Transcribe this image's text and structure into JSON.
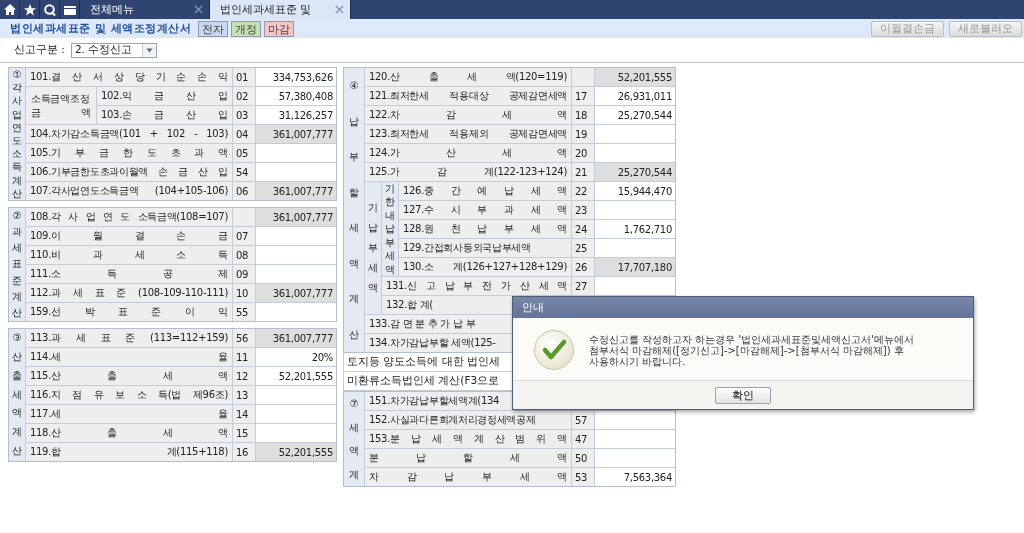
{
  "tabs": [
    {
      "label": "전체메뉴",
      "selected": false
    },
    {
      "label": "법인세과세표준 및",
      "selected": true
    }
  ],
  "form_title": "법인세과세표준 및 세액조정계산서",
  "badges": [
    {
      "label": "전자",
      "color": "#c8d8ee"
    },
    {
      "label": "개정",
      "color": "#c5e2b3"
    },
    {
      "label": "마감",
      "color": "#f6c4c4"
    }
  ],
  "toolbar_buttons": [
    {
      "label": "이월결손금",
      "disabled": true
    },
    {
      "label": "새로불러오",
      "disabled": true
    }
  ],
  "filing_type": {
    "label": "신고구분 :",
    "value": "2. 수정신고"
  },
  "panels": [
    [
      {
        "kind": "section",
        "header": "①각사업연도소득계산",
        "rows": [
          {
            "kind": "line",
            "label": "101.결 산 서 상 당 기 순 손 익",
            "code": "01",
            "value": "334,753,626",
            "computed": false
          },
          {
            "kind": "group",
            "label": "소득금액조정\n금 액",
            "rows": [
              {
                "kind": "line",
                "label": "102.익 금 산 입",
                "code": "02",
                "value": "57,380,408",
                "computed": false
              },
              {
                "kind": "line",
                "label": "103.손 금 산 입",
                "code": "03",
                "value": "31,126,257",
                "computed": false
              }
            ]
          },
          {
            "kind": "line",
            "label": "104.차가감소득금액(101 + 102 - 103)",
            "code": "04",
            "value": "361,007,777",
            "computed": true
          },
          {
            "kind": "line",
            "label": "105.기 부 금 한 도 초 과 액",
            "code": "05",
            "computed": false
          },
          {
            "kind": "line",
            "label": "106.기부금한도초과이월액 손 금 산 입",
            "code": "54",
            "computed": false
          },
          {
            "kind": "line",
            "label": "107.각사업연도소득금액 (104+105-106)",
            "code": "06",
            "value": "361,007,777",
            "computed": true
          }
        ]
      },
      {
        "kind": "section",
        "header": "②과세표준계산",
        "rows": [
          {
            "kind": "line",
            "label": "108.각 사 업 연 도 소득금액(108=107)",
            "value": "361,007,777",
            "computed": true
          },
          {
            "kind": "line",
            "label": "109.이 월 결 손 금",
            "code": "07",
            "computed": false
          },
          {
            "kind": "line",
            "label": "110.비 과 세 소 득",
            "code": "08",
            "computed": false
          },
          {
            "kind": "line",
            "label": "111.소 득 공 제",
            "code": "09",
            "computed": false
          },
          {
            "kind": "line",
            "label": "112.과 세 표 준 (108-109-110-111)",
            "code": "10",
            "value": "361,007,777",
            "computed": true
          },
          {
            "kind": "line",
            "label": "159.선 박 표 준 이 익",
            "code": "55",
            "computed": false
          }
        ]
      },
      {
        "kind": "section",
        "header": "③산출세액계산",
        "rows": [
          {
            "kind": "line",
            "label": "113.과 세 표 준 (113=112+159)",
            "code": "56",
            "value": "361,007,777",
            "computed": true
          },
          {
            "kind": "line",
            "label": "114.세 율",
            "code": "11",
            "value": "20%",
            "computed": false
          },
          {
            "kind": "line",
            "label": "115.산 출 세 액",
            "code": "12",
            "value": "52,201,555",
            "computed": false
          },
          {
            "kind": "line",
            "label": "116.지 점 유 보 소 득(법 제96조)",
            "code": "13",
            "computed": false
          },
          {
            "kind": "line",
            "label": "117.세 율",
            "code": "14",
            "computed": false
          },
          {
            "kind": "line",
            "label": "118.산 출 세 액",
            "code": "15",
            "computed": false
          },
          {
            "kind": "line",
            "label": "119.합 계(115+118)",
            "code": "16",
            "value": "52,201,555",
            "computed": true
          }
        ]
      }
    ],
    [
      {
        "kind": "section",
        "header": "④납부할세액계산",
        "rows": [
          {
            "kind": "line",
            "label": "120.산 출 세 액(120=119)",
            "value": "52,201,555",
            "computed": true
          },
          {
            "kind": "line",
            "label": "121.최저한세 적용대상 공제감면세액",
            "code": "17",
            "value": "26,931,011",
            "computed": false
          },
          {
            "kind": "line",
            "label": "122.차 감 세 액",
            "code": "18",
            "value": "25,270,544",
            "computed": false
          },
          {
            "kind": "line",
            "label": "123.최저한세 적용제외 공제감면세액",
            "code": "19",
            "computed": false
          },
          {
            "kind": "line",
            "label": "124.가 산 세 액",
            "code": "20",
            "computed": false
          },
          {
            "kind": "line",
            "label": "125.가 감 계(122-123+124)",
            "code": "21",
            "value": "25,270,544",
            "computed": true
          },
          {
            "kind": "group",
            "label": "기납부세액",
            "rows": [
              {
                "kind": "group",
                "label": "기한내납부세액",
                "rows": [
                  {
                    "kind": "line",
                    "label": "126.중 간 예 납 세 액",
                    "code": "22",
                    "value": "15,944,470",
                    "computed": false
                  },
                  {
                    "kind": "line",
                    "label": "127.수 시 부 과 세 액",
                    "code": "23",
                    "computed": false
                  },
                  {
                    "kind": "line",
                    "label": "128.원 천 납 부 세 액",
                    "code": "24",
                    "value": "1,762,710",
                    "computed": false
                  },
                  {
                    "kind": "line",
                    "label": "129.간접회사등외국납부세액",
                    "code": "25",
                    "computed": false
                  },
                  {
                    "kind": "line",
                    "label": "130.소 계(126+127+128+129)",
                    "code": "26",
                    "value": "17,707,180",
                    "computed": true
                  }
                ]
              },
              {
                "kind": "line",
                "label": "131.신 고 납 부 전 가 산 세 액",
                "code": "27",
                "computed": false
              },
              {
                "kind": "cut",
                "label": "132.합 계("
              }
            ]
          },
          {
            "kind": "cut",
            "label": "133.감 면 분 추 가 납 부"
          },
          {
            "kind": "cut",
            "label": "134.차가감납부할 세액(125-"
          }
        ]
      },
      {
        "kind": "note",
        "text": "토지등 양도소득에 대한 법인세"
      },
      {
        "kind": "note",
        "text": "미환류소득법인세 계산(F3으로"
      },
      {
        "kind": "section",
        "header": "⑦세액계",
        "rows": [
          {
            "kind": "cut",
            "label": "151.차가감납부할세액계(134"
          },
          {
            "kind": "line",
            "label": "152.사실과다른회계처리경정세액공제",
            "code": "57",
            "computed": false
          },
          {
            "kind": "line",
            "label": "153.분 납 세 액 계 산 범 위 액",
            "code": "47",
            "computed": false
          },
          {
            "kind": "line",
            "label": "분 납 할 세 액",
            "code": "50",
            "computed": false
          },
          {
            "kind": "line",
            "label": "차 감 납 부 세 액",
            "code": "53",
            "value": "7,563,364",
            "computed": false
          }
        ]
      }
    ]
  ],
  "dialog": {
    "title": "안내",
    "message": "수정신고를 작성하고자 하는경우 '법인세과세표준및세액신고서'메뉴에서\n첨부서식 마감해제([정기신고]->[마감해제]->[첨부서식 마감해제]) 후\n사용하시기 바랍니다.",
    "button": "확인"
  }
}
